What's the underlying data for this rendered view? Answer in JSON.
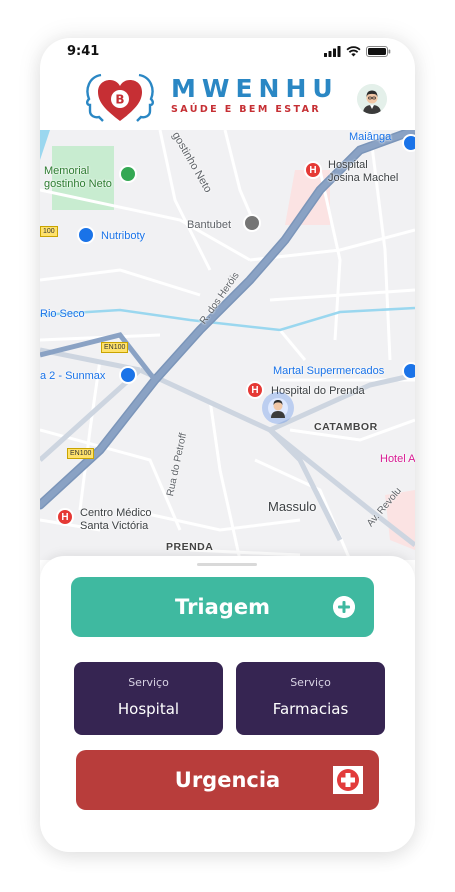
{
  "status_bar": {
    "time": "9:41"
  },
  "header": {
    "logo_letter": "B",
    "brand_name": "MWENHU",
    "brand_tagline": "SAÚDE E BEM ESTAR"
  },
  "map": {
    "labels": {
      "maianga": "Maiânga",
      "agostinho_neto_street": "gostinho Neto",
      "hospital_josina_machel": "Hospital\nJosina Machel",
      "memorial": "Memorial\ngostinho Neto",
      "bantubet": "Bantubet",
      "nutriboty": "Nutriboty",
      "rua_dos_herois": "R. dos Heróis",
      "rio_seco": "Rio Seco",
      "martal": "Martal Supermercados",
      "sunmax": "a 2 - Sunmax",
      "hospital_prenda": "Hospital do Prenda",
      "catambor": "CATAMBOR",
      "rua_do_petroff": "Rua do Petroff",
      "hotel": "Hotel A",
      "massulo": "Massulo",
      "centro_medico": "Centro Médico\nSanta Victória",
      "av_revolucao": "Av. Revolu",
      "prenda": "PRENDA",
      "en100_a": "EN100",
      "en100_b": "EN100",
      "en100_c": "100"
    },
    "pin_letter": "H"
  },
  "actions": {
    "triagem_label": "Triagem",
    "hospital_service": {
      "top": "Serviço",
      "main": "Hospital"
    },
    "farmacias_service": {
      "top": "Serviço",
      "main": "Farmacias"
    },
    "urgencia_label": "Urgencia"
  },
  "colors": {
    "triagem": "#3fb9a0",
    "service": "#362552",
    "urgencia": "#b83d3b",
    "brand_blue": "#2a87c4",
    "brand_red": "#c62f34"
  },
  "icons": [
    "signal-icon",
    "wifi-icon",
    "battery-icon",
    "plus-circle-icon",
    "cross-icon",
    "hospital-pin-icon",
    "user-location-icon"
  ]
}
